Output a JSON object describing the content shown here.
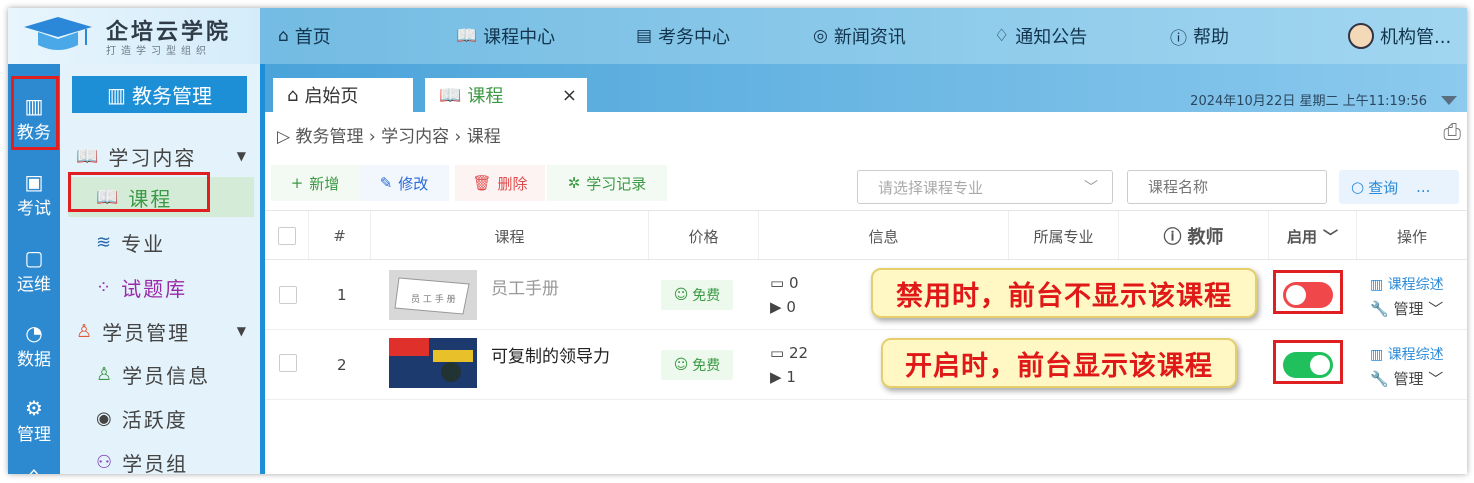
{
  "brand": {
    "name": "企培云学院",
    "slogan": "打造学习型组织"
  },
  "topnav": {
    "items": [
      {
        "icon": "home-icon",
        "label": "首页"
      },
      {
        "icon": "book-icon",
        "label": "课程中心"
      },
      {
        "icon": "exam-icon",
        "label": "考务中心"
      },
      {
        "icon": "news-icon",
        "label": "新闻资讯"
      },
      {
        "icon": "bell-icon",
        "label": "通知公告"
      },
      {
        "icon": "help-icon",
        "label": "帮助"
      }
    ],
    "user": "机构管..."
  },
  "leftnav": {
    "items": [
      {
        "label": "教务",
        "icon": "library-icon"
      },
      {
        "label": "考试",
        "icon": "exam-icon"
      },
      {
        "label": "运维",
        "icon": "ops-icon"
      },
      {
        "label": "数据",
        "icon": "pie-chart-icon"
      },
      {
        "label": "管理",
        "icon": "gear-icon"
      }
    ]
  },
  "sidebar": {
    "header": "教务管理",
    "items": [
      {
        "label": "学习内容",
        "icon": "book-icon"
      },
      {
        "label": "课程",
        "icon": "book-icon"
      },
      {
        "label": "专业",
        "icon": "stack-icon"
      },
      {
        "label": "试题库",
        "icon": "quiz-icon"
      },
      {
        "label": "学员管理",
        "icon": "user-icon"
      },
      {
        "label": "学员信息",
        "icon": "user-icon"
      },
      {
        "label": "活跃度",
        "icon": "activity-icon"
      },
      {
        "label": "学员组",
        "icon": "group-icon"
      }
    ]
  },
  "tabs": [
    {
      "label": "启始页"
    },
    {
      "label": "课程",
      "close": "×"
    }
  ],
  "datetime": "2024年10月22日 星期二 上午11:19:56",
  "breadcrumb": [
    "教务管理",
    "学习内容",
    "课程"
  ],
  "toolbar": {
    "add": "新增",
    "edit": "修改",
    "delete": "删除",
    "record": "学习记录"
  },
  "filters": {
    "major_placeholder": "请选择课程专业",
    "name_placeholder": "课程名称",
    "query": "查询",
    "more": "..."
  },
  "table": {
    "headers": {
      "index": "#",
      "course": "课程",
      "price": "价格",
      "info": "信息",
      "major": "所属专业",
      "teacher": "教师",
      "enabled": "启用",
      "actions": "操作"
    },
    "rows": [
      {
        "index": "1",
        "title": "员工手册",
        "price": "免费",
        "a": "0",
        "b": "0",
        "enabled": false
      },
      {
        "index": "2",
        "title": "可复制的领导力",
        "price": "免费",
        "a": "22",
        "b": "1",
        "enabled": true
      }
    ],
    "row_actions": {
      "overview": "课程综述",
      "manage": "管理"
    }
  },
  "callouts": {
    "disabled": "禁用时，前台不显示该课程",
    "enabled": "开启时，前台显示该课程"
  },
  "colors": {
    "primary": "#1d8fd6",
    "toggle_on": "#20c05c",
    "toggle_off": "#f0474b",
    "highlight": "#e02020"
  }
}
